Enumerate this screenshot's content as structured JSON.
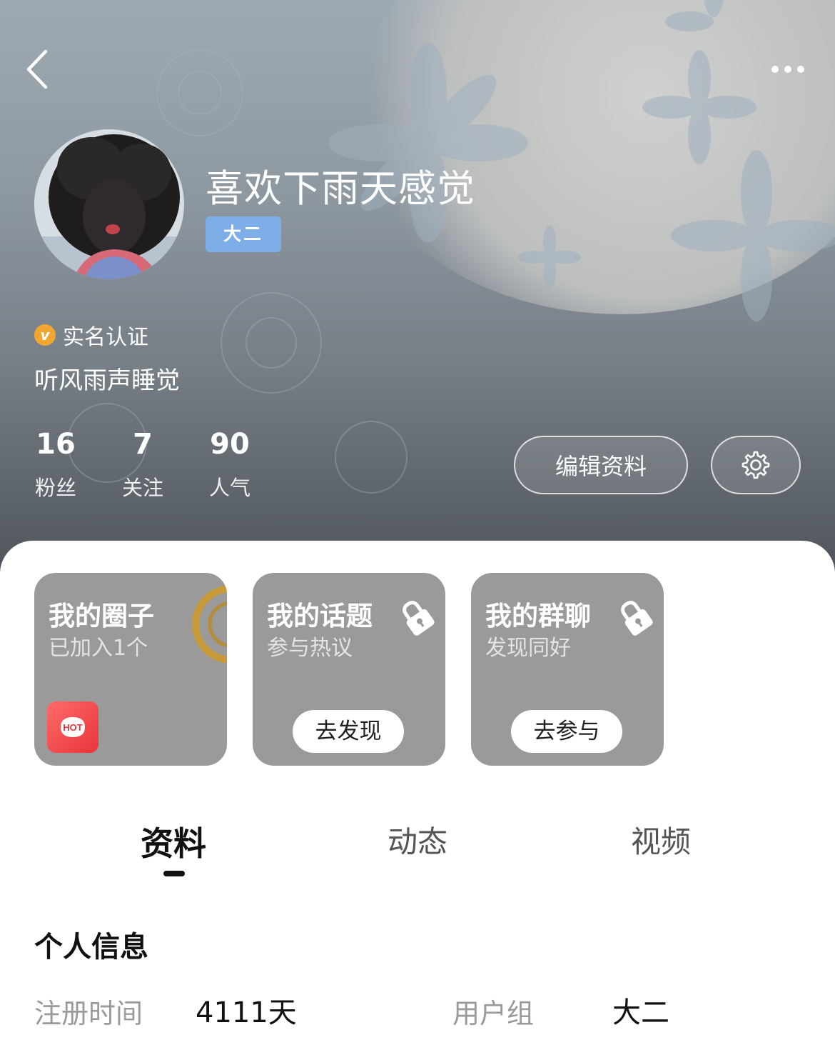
{
  "nav": {
    "back_icon": "chevron-left-icon",
    "more_icon": "more-horizontal-icon"
  },
  "profile": {
    "username": "喜欢下雨天感觉",
    "grade_badge": "大二",
    "verification": {
      "icon": "verified-v-icon",
      "text": "实名认证"
    },
    "bio": "听风雨声睡觉",
    "stats": [
      {
        "value": "16",
        "label": "粉丝"
      },
      {
        "value": "7",
        "label": "关注"
      },
      {
        "value": "90",
        "label": "人气"
      }
    ],
    "edit_button": "编辑资料",
    "settings_icon": "gear-icon"
  },
  "cards": [
    {
      "title": "我的圈子",
      "subtitle": "已加入1个",
      "icon": "hot-icon",
      "hot_text": "HOT"
    },
    {
      "title": "我的话题",
      "subtitle": "参与热议",
      "icon": "lock-icon",
      "button": "去发现"
    },
    {
      "title": "我的群聊",
      "subtitle": "发现同好",
      "icon": "lock-icon",
      "button": "去参与"
    }
  ],
  "tabs": {
    "items": [
      "资料",
      "动态",
      "视频"
    ],
    "active": "资料"
  },
  "personal_info": {
    "title": "个人信息",
    "fields": [
      {
        "label": "注册时间",
        "value": "4111天"
      },
      {
        "label": "用户组",
        "value": "大二"
      }
    ]
  },
  "colors": {
    "badge_blue": "#7eaee8",
    "verify_orange": "#f2a531",
    "card_gray": "#9a9a9a",
    "hot_red": "#e8343a"
  }
}
